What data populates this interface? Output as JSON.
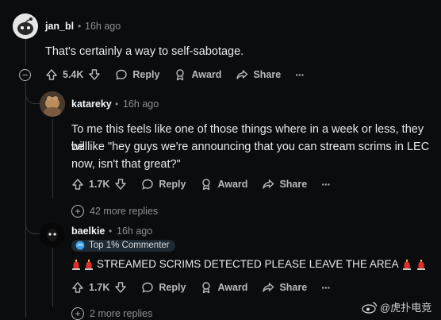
{
  "comments": [
    {
      "user": "jan_bl",
      "time": "16h ago",
      "text": "That's certainly a way to self-sabotage.",
      "votes": "5.4K",
      "actions": {
        "reply": "Reply",
        "award": "Award",
        "share": "Share",
        "more": "···"
      }
    },
    {
      "user": "katareky",
      "time": "16h ago",
      "text_lines": [
        "To me this feels like one of those things where in a week or less, they will",
        "be like \"hey guys we're announcing that you can stream scrims in LEC",
        "now, isn't that great?\""
      ],
      "votes": "1.7K",
      "actions": {
        "reply": "Reply",
        "award": "Award",
        "share": "Share",
        "more": "···"
      },
      "more_replies": "42 more replies"
    },
    {
      "user": "baelkie",
      "time": "16h ago",
      "flair": "Top 1% Commenter",
      "text": "STREAMED SCRIMS DETECTED PLEASE LEAVE THE AREA",
      "votes": "1.7K",
      "actions": {
        "reply": "Reply",
        "award": "Award",
        "share": "Share",
        "more": "···"
      },
      "more_replies": "2 more replies"
    }
  ],
  "separator": "•",
  "collapse_symbol": "−",
  "expand_symbol": "+",
  "watermark": "@虎扑电竞",
  "colors": {
    "background": "#0b0c0e",
    "text": "#e8eaed",
    "muted": "#8b8f94",
    "flair_bg": "#1d2a33"
  }
}
